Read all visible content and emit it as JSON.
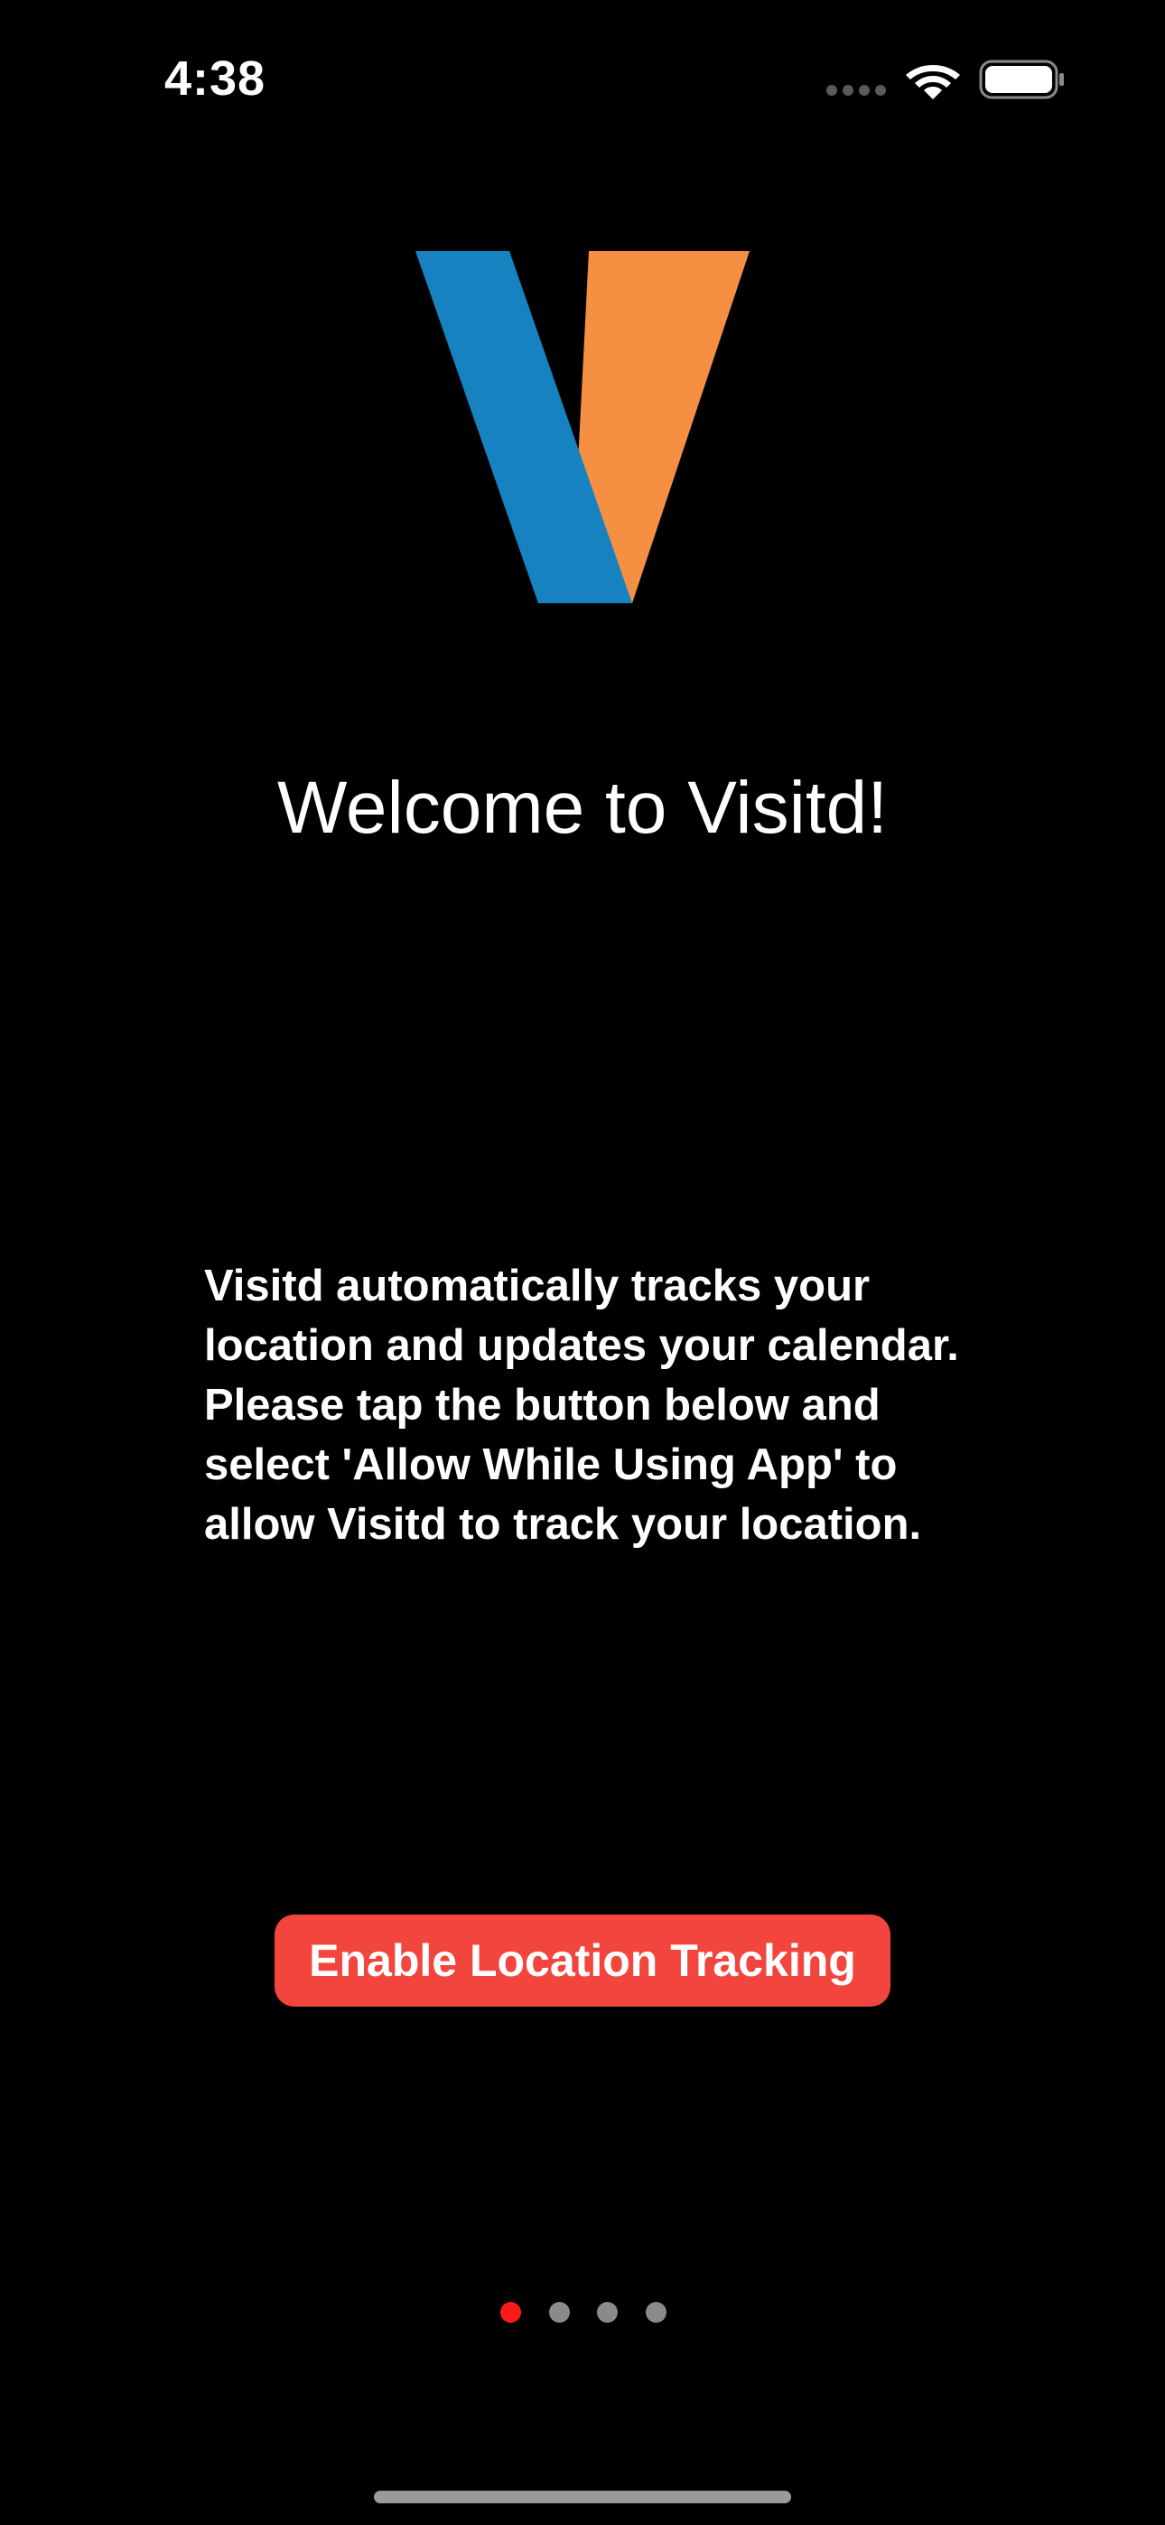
{
  "status_bar": {
    "time": "4:38",
    "wifi_icon": "wifi-icon",
    "battery_icon": "battery-icon",
    "signal_icon": "cellular-signal-icon"
  },
  "logo": {
    "icon": "visitd-v-logo",
    "colors": {
      "blue": "#1682c0",
      "orange": "#f58f42"
    }
  },
  "welcome": {
    "title": "Welcome to Visitd!"
  },
  "description": {
    "text": "Visitd automatically tracks your location and updates your calendar. Please tap the button below and select 'Allow While Using App' to allow Visitd to track your location."
  },
  "actions": {
    "enable_label": "Enable Location Tracking",
    "enable_color": "#f2453d"
  },
  "pager": {
    "page_count": 4,
    "current_page": 1,
    "active_color": "#ff1a1a",
    "inactive_color": "#8a8a8a"
  }
}
